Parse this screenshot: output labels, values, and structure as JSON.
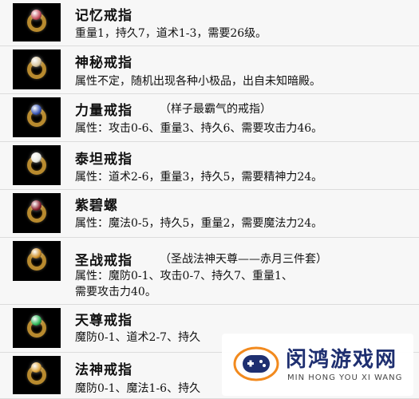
{
  "items": [
    {
      "name": "记忆戒指",
      "note": "",
      "lines": [
        "重量1，持久7，道术1-3，需要26级。"
      ],
      "gem": "#c24a5a"
    },
    {
      "name": "神秘戒指",
      "note": "",
      "lines": [
        "属性不定，随机出现各种小极品，出自未知暗殿。"
      ],
      "gem": "#d9c7a0"
    },
    {
      "name": "力量戒指",
      "note": "（样子最霸气的戒指）",
      "lines": [
        "属性：攻击0-6、重量3、持久6、需要攻击力46。"
      ],
      "gem": "#3a58b8"
    },
    {
      "name": "泰坦戒指",
      "note": "",
      "lines": [
        "属性：道术2-6，重量3，持久5，需要精神力24。"
      ],
      "gem": "#e8e8e0"
    },
    {
      "name": "紫碧螺",
      "note": "",
      "lines": [
        "属性：魔法0-5，持久5，重量2，需要魔法力24。"
      ],
      "gem": "#8a2030"
    },
    {
      "name": "圣战戒指",
      "note": "（圣战法神天尊——赤月三件套）",
      "lines": [
        "属性：魔防0-1、攻击0-7、持久7、重量1、",
        "需要攻击力40。"
      ],
      "gem": "#d0902a"
    },
    {
      "name": "天尊戒指",
      "note": "",
      "lines": [
        "魔防0-1、道术2-7、持久"
      ],
      "gem": "#2fb85a"
    },
    {
      "name": "法神戒指",
      "note": "",
      "lines": [
        "魔防0-1、魔法1-6、持久"
      ],
      "gem": "#e0a840"
    }
  ],
  "watermark": {
    "title": "闵鸿游戏网",
    "subtitle": "MIN HONG YOU XI WANG",
    "colors": {
      "navy": "#1e2f70",
      "orange": "#f28a1e"
    }
  }
}
